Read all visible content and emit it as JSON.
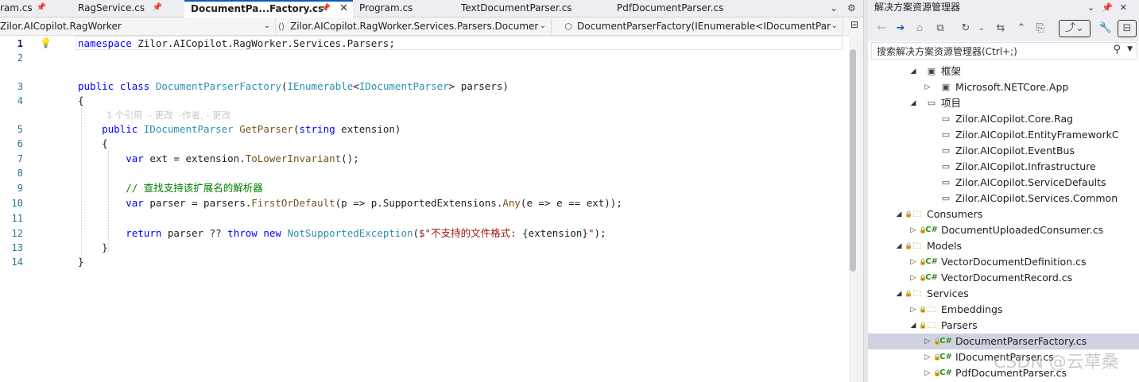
{
  "tabs": [
    {
      "label": "ram.cs",
      "pinned": true
    },
    {
      "label": "RagService.cs",
      "pinned": true
    },
    {
      "label": "DocumentPa...Factory.cs",
      "pinned": true,
      "active": true
    },
    {
      "label": "Program.cs"
    },
    {
      "label": "TextDocumentParser.cs"
    },
    {
      "label": "PdfDocumentParser.cs"
    }
  ],
  "tab_overflow": "⌄",
  "tab_settings": "⚙",
  "nav": {
    "project": "Zilor.AICopilot.RagWorker",
    "namespace": "Zilor.AICopilot.RagWorker.Services.Parsers.Documer",
    "member": "DocumentParserFactory(IEnumerable<IDocumentPar"
  },
  "line_numbers": [
    "1",
    "2",
    "3",
    "4",
    "5",
    "6",
    "7",
    "8",
    "9",
    "10",
    "11",
    "12",
    "13",
    "14"
  ],
  "codelens": "1 个引用  - 更改  -作者, - 更改",
  "code": {
    "l1_kw": "namespace",
    "l1_rest": " Zilor.AICopilot.RagWorker.Services.Parsers;",
    "l3_kw1": "public",
    "l3_kw2": "class",
    "l3_type": "DocumentParserFactory",
    "l3_p1": "(",
    "l3_type2": "IEnumerable",
    "l3_p2": "<",
    "l3_type3": "IDocumentParser",
    "l3_p3": "> parsers)",
    "l4": "{",
    "l5_kw": "public",
    "l5_type": "IDocumentParser",
    "l5_fn": "GetParser",
    "l5_p1": "(",
    "l5_kw2": "string",
    "l5_p2": " extension)",
    "l6": "{",
    "l7_kw": "var",
    "l7_a": " ext = extension.",
    "l7_fn": "ToLowerInvariant",
    "l7_b": "();",
    "l9_cm": "// 查找支持该扩展名的解析器",
    "l10_kw": "var",
    "l10_a": " parser = parsers.",
    "l10_fn": "FirstOrDefault",
    "l10_b": "(p => p.SupportedExtensions.",
    "l10_fn2": "Any",
    "l10_c": "(e => e == ext));",
    "l12_kw": "return",
    "l12_a": " parser ?? ",
    "l12_kw2": "throw",
    "l12_kw3": "new",
    "l12_type": "NotSupportedException",
    "l12_b": "(",
    "l12_st1": "$\"不支持的文件格式: ",
    "l12_c": "{extension}",
    "l12_st2": "\"",
    "l12_d": ");",
    "l13": "}",
    "l14": "}"
  },
  "solution_explorer": {
    "title": "解决方案资源管理器",
    "search_placeholder": "搜索解决方案资源管理器(Ctrl+;)",
    "tree": [
      {
        "label": "框架",
        "depth": 4,
        "exp": "◢",
        "icon": "▣"
      },
      {
        "label": "Microsoft.NETCore.App",
        "depth": 5,
        "exp": "▷",
        "icon": "▣"
      },
      {
        "label": "项目",
        "depth": 4,
        "exp": "◢",
        "icon": "▭"
      },
      {
        "label": "Zilor.AICopilot.Core.Rag",
        "depth": 5,
        "icon": "▭"
      },
      {
        "label": "Zilor.AICopilot.EntityFrameworkC",
        "depth": 5,
        "icon": "▭"
      },
      {
        "label": "Zilor.AICopilot.EventBus",
        "depth": 5,
        "icon": "▭"
      },
      {
        "label": "Zilor.AICopilot.Infrastructure",
        "depth": 5,
        "icon": "▭"
      },
      {
        "label": "Zilor.AICopilot.ServiceDefaults",
        "depth": 5,
        "icon": "▭"
      },
      {
        "label": "Zilor.AICopilot.Services.Common",
        "depth": 5,
        "icon": "▭"
      },
      {
        "label": "Consumers",
        "depth": 3,
        "exp": "◢",
        "icon": "folder",
        "lock": true
      },
      {
        "label": "DocumentUploadedConsumer.cs",
        "depth": 4,
        "exp": "▷",
        "icon": "cs",
        "lock": true
      },
      {
        "label": "Models",
        "depth": 3,
        "exp": "◢",
        "icon": "folder",
        "lock": true
      },
      {
        "label": "VectorDocumentDefinition.cs",
        "depth": 4,
        "exp": "▷",
        "icon": "cs",
        "lock": true
      },
      {
        "label": "VectorDocumentRecord.cs",
        "depth": 4,
        "exp": "▷",
        "icon": "cs",
        "lock": true
      },
      {
        "label": "Services",
        "depth": 3,
        "exp": "◢",
        "icon": "folder",
        "lock": true
      },
      {
        "label": "Embeddings",
        "depth": 4,
        "exp": "▷",
        "icon": "folder",
        "lock": true
      },
      {
        "label": "Parsers",
        "depth": 4,
        "exp": "◢",
        "icon": "folder",
        "lock": true
      },
      {
        "label": "DocumentParserFactory.cs",
        "depth": 5,
        "exp": "▷",
        "icon": "cs",
        "lock": true,
        "selected": true
      },
      {
        "label": "IDocumentParser.cs",
        "depth": 5,
        "exp": "▷",
        "icon": "cs",
        "lock": true
      },
      {
        "label": "PdfDocumentParser.cs",
        "depth": 5,
        "exp": "▷",
        "icon": "cs",
        "lock": true
      }
    ]
  },
  "watermark": "CSDN @云草桑"
}
